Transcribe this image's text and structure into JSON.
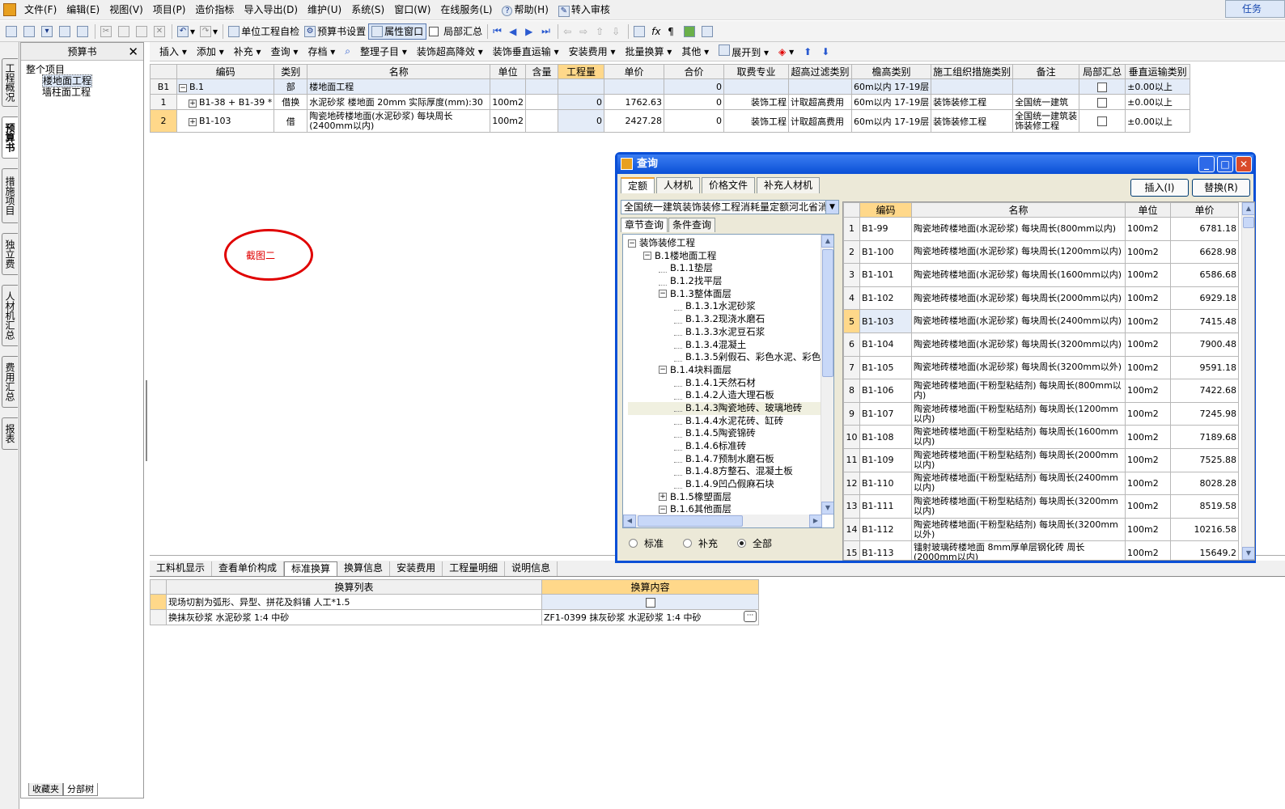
{
  "menu": [
    "文件(F)",
    "编辑(E)",
    "视图(V)",
    "项目(P)",
    "造价指标",
    "导入导出(D)",
    "维护(U)",
    "系统(S)",
    "窗口(W)",
    "在线服务(L)",
    "帮助(H)",
    "转入审核"
  ],
  "task_button": "任务",
  "toolbar": {
    "unit_check": "单位工程自检",
    "budget_settings": "预算书设置",
    "property_window": "属性窗口",
    "local_summary": "局部汇总"
  },
  "side_tabs": [
    "工程概况",
    "预算书",
    "措施项目",
    "独立费",
    "人材机汇总",
    "费用汇总",
    "报表"
  ],
  "left_panel": {
    "title": "预算书",
    "tree": [
      "整个项目",
      "楼地面工程",
      "墙柱面工程"
    ],
    "bottom_tabs": [
      "收藏夹",
      "分部树"
    ]
  },
  "grid_toolbar": [
    "插入",
    "添加",
    "补充",
    "查询",
    "存档",
    "整理子目",
    "装饰超高降效",
    "装饰垂直运输",
    "安装费用",
    "批量换算",
    "其他",
    "展开到"
  ],
  "main_grid": {
    "headers": [
      "编码",
      "类别",
      "名称",
      "单位",
      "含量",
      "工程量",
      "单价",
      "合价",
      "取费专业",
      "超高过滤类别",
      "檐高类别",
      "施工组织措施类别",
      "备注",
      "局部汇总",
      "垂直运输类别"
    ],
    "rows": [
      {
        "no": "B1",
        "code": "B.1",
        "type": "部",
        "name": "楼地面工程",
        "unit": "",
        "content": "",
        "qty": "",
        "price": "",
        "total": "0",
        "fee": "",
        "filter": "",
        "eave": "60m以内 17-19层",
        "org": "",
        "remark": "",
        "vert": "±0.00以上"
      },
      {
        "no": "1",
        "code": "B1-38 + B1-39 *",
        "type": "借换",
        "name": "水泥砂浆 楼地面 20mm 实际厚度(mm):30",
        "unit": "100m2",
        "content": "",
        "qty": "0",
        "price": "1762.63",
        "total": "0",
        "fee": "装饰工程",
        "filter": "计取超高费用",
        "eave": "60m以内 17-19层",
        "org": "装饰装修工程",
        "remark": "全国统一建筑",
        "vert": "±0.00以上"
      },
      {
        "no": "2",
        "code": "B1-103",
        "type": "借",
        "name": "陶瓷地砖楼地面(水泥砂浆) 每块周长(2400mm以内)",
        "unit": "100m2",
        "content": "",
        "qty": "0",
        "price": "2427.28",
        "total": "0",
        "fee": "装饰工程",
        "filter": "计取超高费用",
        "eave": "60m以内 17-19层",
        "org": "装饰装修工程",
        "remark": "全国统一建筑装饰装修工程",
        "vert": "±0.00以上"
      }
    ]
  },
  "annotation": "截图二",
  "bottom_tabs": [
    "工料机显示",
    "查看单价构成",
    "标准换算",
    "换算信息",
    "安装费用",
    "工程量明细",
    "说明信息"
  ],
  "sub_grid": {
    "headers": [
      "换算列表",
      "换算内容"
    ],
    "rows": [
      {
        "list": "现场切割为弧形、异型、拼花及斜铺 人工*1.5",
        "content": ""
      },
      {
        "list": "换抹灰砂浆 水泥砂浆 1:4 中砂",
        "content": "ZF1-0399 抹灰砂浆 水泥砂浆 1:4 中砂"
      }
    ]
  },
  "dialog": {
    "title": "查询",
    "tabs": [
      "定额",
      "人材机",
      "价格文件",
      "补充人材机"
    ],
    "insert_button": "插入(I)",
    "replace_button": "替换(R)",
    "library": "全国统一建筑装饰装修工程消耗量定额河北省消耗量定额",
    "subtabs": [
      "章节查询",
      "条件查询"
    ],
    "tree": [
      {
        "label": "装饰装修工程",
        "level": 0,
        "toggle": "−"
      },
      {
        "label": "B.1楼地面工程",
        "level": 1,
        "toggle": "−"
      },
      {
        "label": "B.1.1垫层",
        "level": 2,
        "toggle": ""
      },
      {
        "label": "B.1.2找平层",
        "level": 2,
        "toggle": ""
      },
      {
        "label": "B.1.3整体面层",
        "level": 2,
        "toggle": "−"
      },
      {
        "label": "B.1.3.1水泥砂浆",
        "level": 3,
        "toggle": ""
      },
      {
        "label": "B.1.3.2现浇水磨石",
        "level": 3,
        "toggle": ""
      },
      {
        "label": "B.1.3.3水泥豆石浆",
        "level": 3,
        "toggle": ""
      },
      {
        "label": "B.1.3.4混凝土",
        "level": 3,
        "toggle": ""
      },
      {
        "label": "B.1.3.5剁假石、彩色水泥、彩色",
        "level": 3,
        "toggle": ""
      },
      {
        "label": "B.1.4块料面层",
        "level": 2,
        "toggle": "−"
      },
      {
        "label": "B.1.4.1天然石材",
        "level": 3,
        "toggle": ""
      },
      {
        "label": "B.1.4.2人造大理石板",
        "level": 3,
        "toggle": ""
      },
      {
        "label": "B.1.4.3陶瓷地砖、玻璃地砖",
        "level": 3,
        "toggle": "",
        "selected": true
      },
      {
        "label": "B.1.4.4水泥花砖、缸砖",
        "level": 3,
        "toggle": ""
      },
      {
        "label": "B.1.4.5陶瓷锦砖",
        "level": 3,
        "toggle": ""
      },
      {
        "label": "B.1.4.6标准砖",
        "level": 3,
        "toggle": ""
      },
      {
        "label": "B.1.4.7预制水磨石板",
        "level": 3,
        "toggle": ""
      },
      {
        "label": "B.1.4.8方整石、混凝土板",
        "level": 3,
        "toggle": ""
      },
      {
        "label": "B.1.4.9凹凸假麻石块",
        "level": 3,
        "toggle": ""
      },
      {
        "label": "B.1.5橡塑面层",
        "level": 2,
        "toggle": "+"
      },
      {
        "label": "B.1.6其他面层",
        "level": 2,
        "toggle": "−"
      }
    ],
    "radios": [
      {
        "label": "标准",
        "checked": false
      },
      {
        "label": "补充",
        "checked": false
      },
      {
        "label": "全部",
        "checked": true
      }
    ],
    "grid_headers": [
      "编码",
      "名称",
      "单位",
      "单价"
    ],
    "grid_rows": [
      {
        "no": "1",
        "code": "B1-99",
        "name": "陶瓷地砖楼地面(水泥砂浆) 每块周长(800mm以内)",
        "unit": "100m2",
        "price": "6781.18"
      },
      {
        "no": "2",
        "code": "B1-100",
        "name": "陶瓷地砖楼地面(水泥砂浆) 每块周长(1200mm以内)",
        "unit": "100m2",
        "price": "6628.98"
      },
      {
        "no": "3",
        "code": "B1-101",
        "name": "陶瓷地砖楼地面(水泥砂浆) 每块周长(1600mm以内)",
        "unit": "100m2",
        "price": "6586.68"
      },
      {
        "no": "4",
        "code": "B1-102",
        "name": "陶瓷地砖楼地面(水泥砂浆) 每块周长(2000mm以内)",
        "unit": "100m2",
        "price": "6929.18"
      },
      {
        "no": "5",
        "code": "B1-103",
        "name": "陶瓷地砖楼地面(水泥砂浆) 每块周长(2400mm以内)",
        "unit": "100m2",
        "price": "7415.48"
      },
      {
        "no": "6",
        "code": "B1-104",
        "name": "陶瓷地砖楼地面(水泥砂浆) 每块周长(3200mm以内)",
        "unit": "100m2",
        "price": "7900.48"
      },
      {
        "no": "7",
        "code": "B1-105",
        "name": "陶瓷地砖楼地面(水泥砂浆) 每块周长(3200mm以外)",
        "unit": "100m2",
        "price": "9591.18"
      },
      {
        "no": "8",
        "code": "B1-106",
        "name": "陶瓷地砖楼地面(干粉型粘结剂) 每块周长(800mm以内)",
        "unit": "100m2",
        "price": "7422.68"
      },
      {
        "no": "9",
        "code": "B1-107",
        "name": "陶瓷地砖楼地面(干粉型粘结剂) 每块周长(1200mm以内)",
        "unit": "100m2",
        "price": "7245.98"
      },
      {
        "no": "10",
        "code": "B1-108",
        "name": "陶瓷地砖楼地面(干粉型粘结剂) 每块周长(1600mm以内)",
        "unit": "100m2",
        "price": "7189.68"
      },
      {
        "no": "11",
        "code": "B1-109",
        "name": "陶瓷地砖楼地面(干粉型粘结剂) 每块周长(2000mm以内)",
        "unit": "100m2",
        "price": "7525.88"
      },
      {
        "no": "12",
        "code": "B1-110",
        "name": "陶瓷地砖楼地面(干粉型粘结剂) 每块周长(2400mm以内)",
        "unit": "100m2",
        "price": "8028.28"
      },
      {
        "no": "13",
        "code": "B1-111",
        "name": "陶瓷地砖楼地面(干粉型粘结剂) 每块周长(3200mm以内)",
        "unit": "100m2",
        "price": "8519.58"
      },
      {
        "no": "14",
        "code": "B1-112",
        "name": "陶瓷地砖楼地面(干粉型粘结剂) 每块周长(3200mm以外)",
        "unit": "100m2",
        "price": "10216.58"
      },
      {
        "no": "15",
        "code": "B1-113",
        "name": "镭射玻璃砖楼地面 8mm厚单层钢化砖 周长(2000mm以内)",
        "unit": "100m2",
        "price": "15649.2"
      }
    ]
  }
}
